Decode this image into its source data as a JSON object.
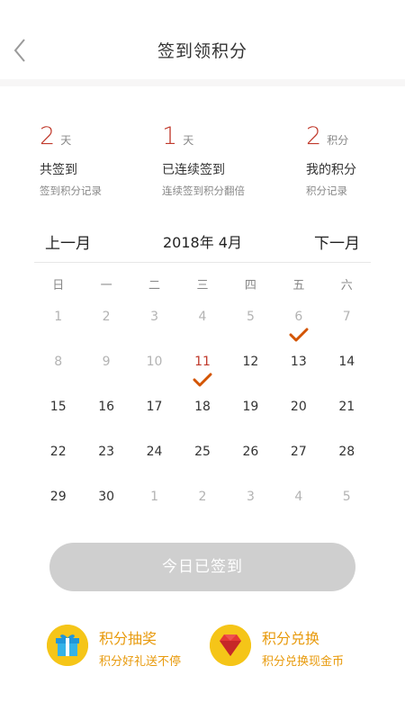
{
  "header": {
    "title": "签到领积分"
  },
  "stats": [
    {
      "num": "2",
      "unit": "天",
      "label": "共签到",
      "sub": "签到积分记录"
    },
    {
      "num": "1",
      "unit": "天",
      "label": "已连续签到",
      "sub": "连续签到积分翻倍"
    },
    {
      "num": "2",
      "unit": "积分",
      "label": "我的积分",
      "sub": "积分记录"
    }
  ],
  "calendar": {
    "prev_label": "上一月",
    "next_label": "下一月",
    "current": "2018年 4月",
    "weekdays": [
      "日",
      "一",
      "二",
      "三",
      "四",
      "五",
      "六"
    ],
    "weeks": [
      [
        "1",
        "2",
        "3",
        "4",
        "5",
        "6",
        "7"
      ],
      [
        "8",
        "9",
        "10",
        "11",
        "12",
        "13",
        "14"
      ],
      [
        "15",
        "16",
        "17",
        "18",
        "19",
        "20",
        "21"
      ],
      [
        "22",
        "23",
        "24",
        "25",
        "26",
        "27",
        "28"
      ],
      [
        "29",
        "30",
        "1",
        "2",
        "3",
        "4",
        "5"
      ]
    ],
    "dim_until": "11",
    "today": "11",
    "checked_days": [
      "6",
      "11"
    ],
    "accent_color": "#c0392b",
    "check_color": "#d35400"
  },
  "sign_button": {
    "label": "今日已签到"
  },
  "promos": [
    {
      "title": "积分抽奖",
      "sub": "积分好礼送不停",
      "icon": "gift-icon"
    },
    {
      "title": "积分兑换",
      "sub": "积分兑换现金币",
      "icon": "ruby-icon"
    }
  ]
}
